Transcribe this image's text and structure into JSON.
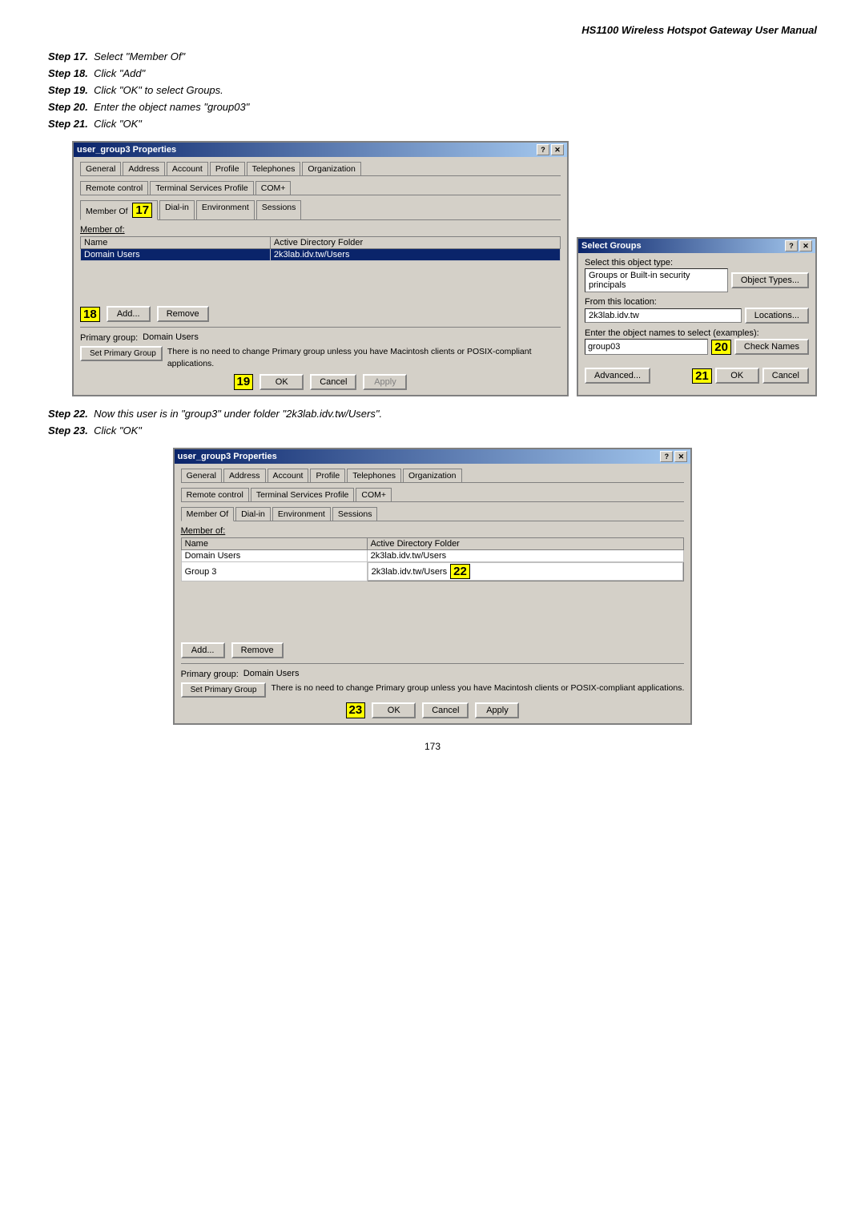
{
  "header": {
    "title": "HS1100 Wireless Hotspot Gateway User Manual"
  },
  "steps": [
    {
      "num": "17",
      "text": "Select \"Member Of\""
    },
    {
      "num": "18",
      "text": "Click \"Add\""
    },
    {
      "num": "19",
      "text": "Click \"OK\" to select Groups."
    },
    {
      "num": "20",
      "text": "Enter the object names \"group03\""
    },
    {
      "num": "21",
      "text": "Click \"OK\""
    }
  ],
  "steps2": [
    {
      "num": "22",
      "text": "Now this user is in \"group3\" under folder \"2k3lab.idv.tw/Users\"."
    },
    {
      "num": "23",
      "text": "Click \"OK\""
    }
  ],
  "dialog1": {
    "title": "user_group3 Properties",
    "tabs_row1": [
      "General",
      "Address",
      "Account",
      "Profile",
      "Telephones",
      "Organization"
    ],
    "tabs_row2": [
      "Remote control",
      "Terminal Services Profile",
      "COM+"
    ],
    "tabs_row3_highlight": "Member Of",
    "tabs_row3": [
      "Member Of",
      "17",
      "Dial-in",
      "Environment",
      "Sessions"
    ],
    "section_label": "Member of:",
    "table_headers": [
      "Name",
      "Active Directory Folder"
    ],
    "table_rows": [
      {
        "name": "Domain Users",
        "folder": "2k3lab.idv.tw/Users"
      }
    ],
    "btn_add": "Add...",
    "btn_remove": "Remove",
    "badge18": "18",
    "primary_group_label": "Primary group:",
    "primary_group_value": "Domain Users",
    "set_primary_label": "Set Primary Group",
    "set_primary_info": "There is no need to change Primary group unless you have Macintosh clients or POSIX-compliant applications.",
    "badge19": "19",
    "btn_ok": "OK",
    "btn_cancel": "Cancel",
    "btn_apply": "Apply"
  },
  "dialog_select_groups": {
    "title": "Select Groups",
    "select_type_label": "Select this object type:",
    "select_type_value": "Groups or Built-in security principals",
    "btn_object_types": "Object Types...",
    "from_location_label": "From this location:",
    "from_location_value": "2k3lab.idv.tw",
    "btn_locations": "Locations...",
    "enter_names_label": "Enter the object names to select (examples):",
    "input_value": "group03",
    "badge20": "20",
    "btn_check_names": "Check Names",
    "btn_advanced": "Advanced...",
    "badge21": "21",
    "btn_ok": "OK",
    "btn_cancel": "Cancel"
  },
  "dialog2": {
    "title": "user_group3 Properties",
    "tabs_row1": [
      "General",
      "Address",
      "Account",
      "Profile",
      "Telephones",
      "Organization"
    ],
    "tabs_row2": [
      "Remote control",
      "Terminal Services Profile",
      "COM+"
    ],
    "tabs_row3": [
      "Member Of",
      "Dial-in",
      "Environment",
      "Sessions"
    ],
    "section_label": "Member of:",
    "table_headers": [
      "Name",
      "Active Directory Folder"
    ],
    "table_rows": [
      {
        "name": "Domain Users",
        "folder": "2k3lab.idv.tw/Users"
      },
      {
        "name": "Group 3",
        "folder": "2k3lab.idv.tw/Users"
      }
    ],
    "badge22": "22",
    "btn_add": "Add...",
    "btn_remove": "Remove",
    "primary_group_label": "Primary group:",
    "primary_group_value": "Domain Users",
    "set_primary_label": "Set Primary Group",
    "set_primary_info": "There is no need to change Primary group unless you have Macintosh clients or POSIX-compliant applications.",
    "badge23": "23",
    "btn_ok": "OK",
    "btn_cancel": "Cancel",
    "btn_apply": "Apply"
  },
  "page_number": "173"
}
